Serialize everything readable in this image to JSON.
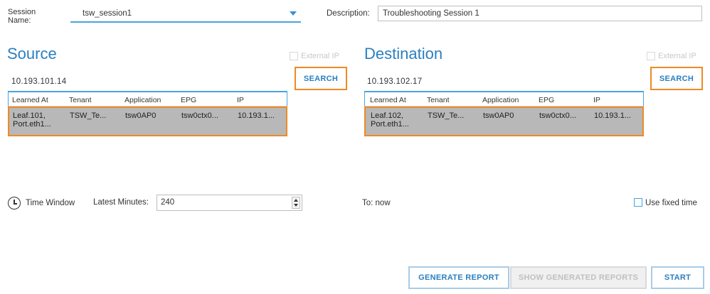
{
  "session": {
    "label": "Session Name:",
    "value": "tsw_session1",
    "description_label": "Description:",
    "description_value": "Troubleshooting Session 1"
  },
  "source": {
    "title": "Source",
    "external_ip_label": "External IP",
    "ip": "10.193.101.14",
    "search_label": "SEARCH",
    "columns": [
      "Learned At",
      "Tenant",
      "Application",
      "EPG",
      "IP"
    ],
    "row": {
      "learned_line1": "Leaf.101,",
      "learned_line2": "Port.eth1...",
      "tenant": "TSW_Te...",
      "application": "tsw0AP0",
      "epg": "tsw0ctx0...",
      "ip": "10.193.1..."
    }
  },
  "destination": {
    "title": "Destination",
    "external_ip_label": "External IP",
    "ip": "10.193.102.17",
    "search_label": "SEARCH",
    "columns": [
      "Learned At",
      "Tenant",
      "Application",
      "EPG",
      "IP"
    ],
    "row": {
      "learned_line1": "Leaf.102,",
      "learned_line2": "Port.eth1...",
      "tenant": "TSW_Te...",
      "application": "tsw0AP0",
      "epg": "tsw0ctx0...",
      "ip": "10.193.1..."
    }
  },
  "time": {
    "window_label": "Time Window",
    "minutes_label": "Latest Minutes:",
    "minutes_value": "240",
    "to_label": "To: now",
    "fixed_time_label": "Use fixed time"
  },
  "actions": {
    "generate": "GENERATE REPORT",
    "show_generated": "SHOW GENERATED REPORTS",
    "start": "START"
  },
  "colors": {
    "accent": "#2a7fc0",
    "highlight": "#ef8a24"
  },
  "icons": {
    "clock": "clock-icon",
    "dropdown": "chevron-down-icon"
  }
}
